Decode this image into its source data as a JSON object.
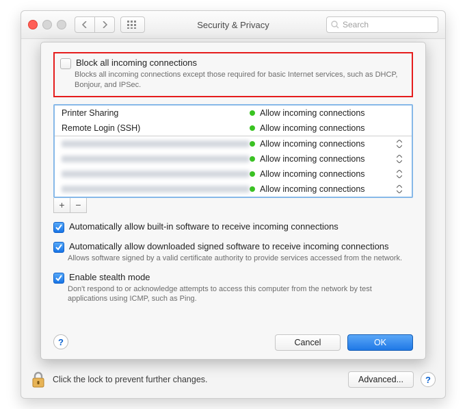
{
  "window": {
    "title": "Security & Privacy",
    "search_placeholder": "Search"
  },
  "block_all": {
    "checked": false,
    "title": "Block all incoming connections",
    "desc": "Blocks all incoming connections except those required for basic Internet services, such as DHCP, Bonjour, and IPSec."
  },
  "firewall_rows": [
    {
      "name": "Printer Sharing",
      "status": "Allow incoming connections",
      "stepper": false,
      "blur": false
    },
    {
      "name": "Remote Login (SSH)",
      "status": "Allow incoming connections",
      "stepper": false,
      "blur": false
    },
    {
      "name": "",
      "status": "Allow incoming connections",
      "stepper": true,
      "blur": true
    },
    {
      "name": "",
      "status": "Allow incoming connections",
      "stepper": true,
      "blur": true
    },
    {
      "name": "",
      "status": "Allow incoming connections",
      "stepper": true,
      "blur": true
    },
    {
      "name": "",
      "status": "Allow incoming connections",
      "stepper": true,
      "blur": true
    }
  ],
  "add_label": "+",
  "remove_label": "−",
  "auto_builtin": {
    "checked": true,
    "title": "Automatically allow built-in software to receive incoming connections"
  },
  "auto_signed": {
    "checked": true,
    "title": "Automatically allow downloaded signed software to receive incoming connections",
    "desc": "Allows software signed by a valid certificate authority to provide services accessed from the network."
  },
  "stealth": {
    "checked": true,
    "title": "Enable stealth mode",
    "desc": "Don't respond to or acknowledge attempts to access this computer from the network by test applications using ICMP, such as Ping."
  },
  "help_glyph": "?",
  "cancel_label": "Cancel",
  "ok_label": "OK",
  "lock_text": "Click the lock to prevent further changes.",
  "advanced_label": "Advanced..."
}
